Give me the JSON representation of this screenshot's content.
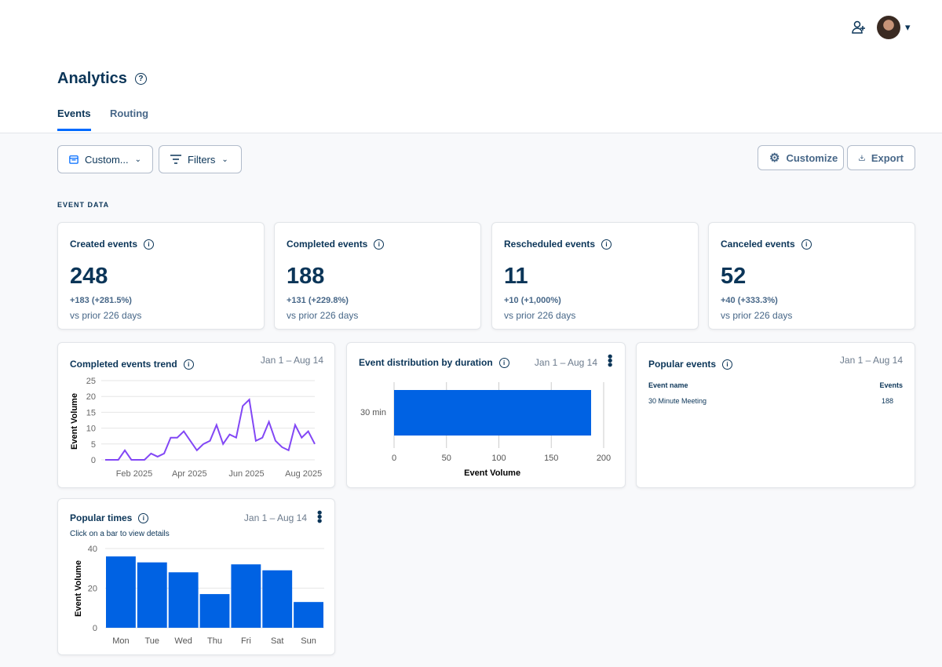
{
  "header": {
    "add_user_icon": "person-plus-icon",
    "avatar_icon": "avatar",
    "caret": "▾"
  },
  "page": {
    "title": "Analytics",
    "help": "?"
  },
  "tabs": [
    {
      "label": "Events",
      "active": true
    },
    {
      "label": "Routing",
      "active": false
    }
  ],
  "toolbar": {
    "date_label": "Custom...",
    "filters_label": "Filters",
    "customize_label": "Customize",
    "export_label": "Export"
  },
  "section_label": "EVENT DATA",
  "stats": [
    {
      "label": "Created events",
      "value": "248",
      "delta": "+183 (+281.5%)",
      "compare": "vs prior 226 days"
    },
    {
      "label": "Completed events",
      "value": "188",
      "delta": "+131 (+229.8%)",
      "compare": "vs prior 226 days"
    },
    {
      "label": "Rescheduled events",
      "value": "11",
      "delta": "+10 (+1,000%)",
      "compare": "vs prior 226 days"
    },
    {
      "label": "Canceled events",
      "value": "52",
      "delta": "+40 (+333.3%)",
      "compare": "vs prior 226 days"
    }
  ],
  "trend": {
    "title": "Completed events trend",
    "range": "Jan 1 – Aug 14"
  },
  "duration": {
    "title": "Event distribution by duration",
    "range": "Jan 1 – Aug 14"
  },
  "popular_events": {
    "title": "Popular events",
    "range": "Jan 1 – Aug 14",
    "col1": "Event name",
    "col2": "Events",
    "rows": [
      {
        "name": "30 Minute Meeting",
        "count": "188"
      }
    ]
  },
  "times": {
    "title": "Popular times",
    "range": "Jan 1 – Aug 14",
    "hint": "Click on a bar to view details"
  },
  "colors": {
    "accent": "#006bff",
    "bar": "#0062e3",
    "line": "#8247f5"
  },
  "chart_data": [
    {
      "type": "line",
      "ylabel": "Event Volume",
      "ylim": [
        0,
        25
      ],
      "yticks": [
        0,
        5,
        10,
        15,
        20,
        25
      ],
      "xtick_labels": [
        "Feb 2025",
        "Apr 2025",
        "Jun 2025",
        "Aug 2025"
      ],
      "xtick_dates": [
        "2025-02-01",
        "2025-04-01",
        "2025-06-01",
        "2025-08-01"
      ],
      "x_start": "2025-01-01",
      "x_step_days": 7,
      "grid": true,
      "values": [
        0,
        0,
        0,
        3,
        0,
        0,
        0,
        2,
        1,
        2,
        7,
        7,
        9,
        6,
        3,
        5,
        6,
        11,
        5,
        8,
        7,
        17,
        19,
        6,
        7,
        12,
        6,
        4,
        3,
        11,
        7,
        9,
        5
      ]
    },
    {
      "type": "bar",
      "orientation": "horizontal",
      "categories": [
        "30 min"
      ],
      "values": [
        188
      ],
      "xlabel": "Event Volume",
      "xlim": [
        0,
        200
      ],
      "xticks": [
        0,
        50,
        100,
        150,
        200
      ]
    },
    {
      "type": "bar",
      "categories": [
        "Mon",
        "Tue",
        "Wed",
        "Thu",
        "Fri",
        "Sat",
        "Sun"
      ],
      "values": [
        36,
        33,
        28,
        17,
        32,
        29,
        13
      ],
      "ylabel": "Event Volume",
      "ylim": [
        0,
        40
      ],
      "yticks": [
        0,
        20,
        40
      ],
      "grid": true
    }
  ]
}
